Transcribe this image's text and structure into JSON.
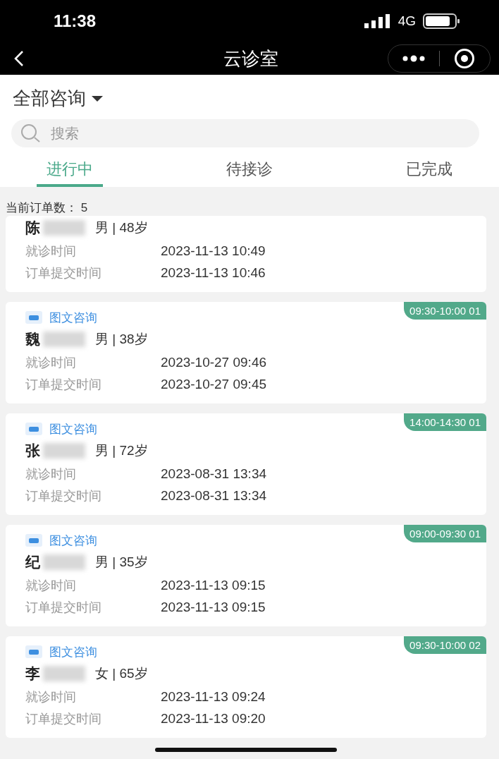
{
  "status_bar": {
    "time": "11:38",
    "network": "4G"
  },
  "nav_bar": {
    "title": "云诊室"
  },
  "filter": {
    "label": "全部咨询"
  },
  "search": {
    "placeholder": "搜索"
  },
  "tabs": [
    {
      "label": "进行中",
      "selected": true
    },
    {
      "label": "待接诊",
      "selected": false
    },
    {
      "label": "已完成",
      "selected": false
    }
  ],
  "order_count": {
    "label": "当前订单数：",
    "value": "5"
  },
  "orders": [
    {
      "partial": true,
      "surname": "陈",
      "gender_age": "男 | 48岁",
      "visit_label": "就诊时间",
      "visit_time": "2023-11-13 10:49",
      "submit_label": "订单提交时间",
      "submit_time": "2023-11-13 10:46"
    },
    {
      "partial": false,
      "type": "图文咨询",
      "slot": "09:30-10:00 01",
      "surname": "魏",
      "gender_age": "男 | 38岁",
      "visit_label": "就诊时间",
      "visit_time": "2023-10-27 09:46",
      "submit_label": "订单提交时间",
      "submit_time": "2023-10-27 09:45"
    },
    {
      "partial": false,
      "type": "图文咨询",
      "slot": "14:00-14:30 01",
      "surname": "张",
      "gender_age": "男 | 72岁",
      "visit_label": "就诊时间",
      "visit_time": "2023-08-31 13:34",
      "submit_label": "订单提交时间",
      "submit_time": "2023-08-31 13:34"
    },
    {
      "partial": false,
      "type": "图文咨询",
      "slot": "09:00-09:30 01",
      "surname": "纪",
      "gender_age": "男 | 35岁",
      "visit_label": "就诊时间",
      "visit_time": "2023-11-13 09:15",
      "submit_label": "订单提交时间",
      "submit_time": "2023-11-13 09:15"
    },
    {
      "partial": false,
      "type": "图文咨询",
      "slot": "09:30-10:00 02",
      "surname": "李",
      "gender_age": "女 | 65岁",
      "visit_label": "就诊时间",
      "visit_time": "2023-11-13 09:24",
      "submit_label": "订单提交时间",
      "submit_time": "2023-11-13 09:20"
    }
  ]
}
